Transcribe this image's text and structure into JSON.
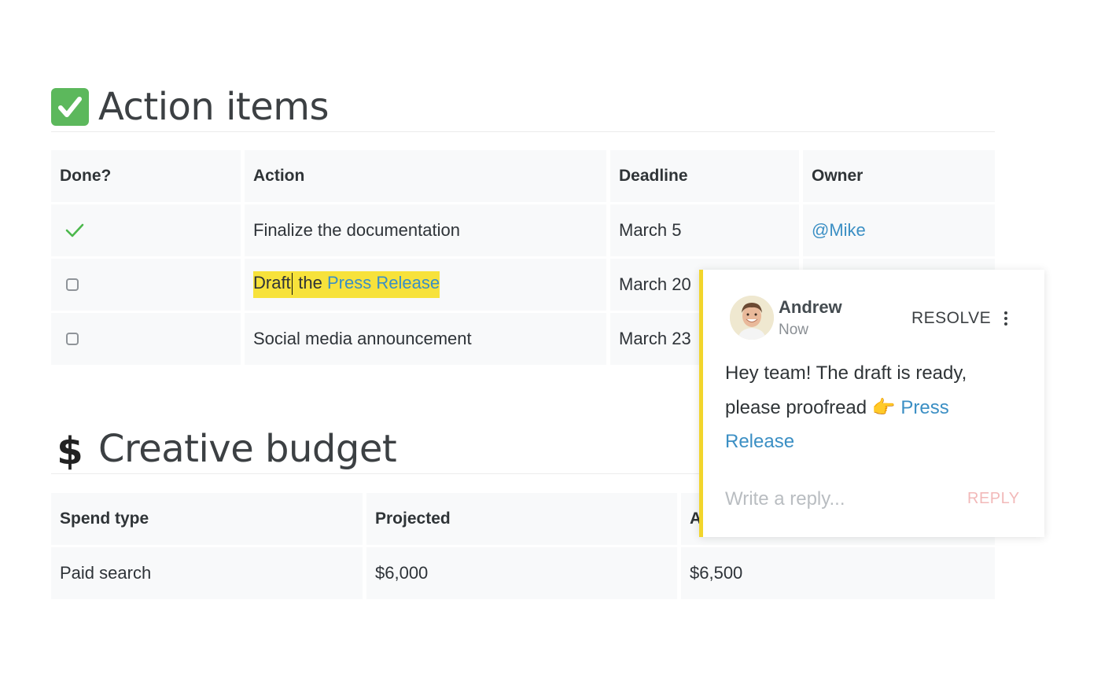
{
  "action_items": {
    "title": "Action items",
    "columns": [
      "Done?",
      "Action",
      "Deadline",
      "Owner"
    ],
    "rows": [
      {
        "done": true,
        "action": "Finalize the documentation",
        "deadline": "March 5",
        "owner": "@Mike"
      },
      {
        "done": false,
        "action_plain": "Draft",
        "action_mid": " the ",
        "action_link": "Press Release",
        "deadline": "March 20",
        "owner": ""
      },
      {
        "done": false,
        "action": "Social media announcement",
        "deadline": "March 23",
        "owner": ""
      }
    ]
  },
  "creative_budget": {
    "title": "Creative budget",
    "icon_glyph": "$",
    "columns": [
      "Spend type",
      "Projected",
      "A"
    ],
    "rows": [
      {
        "spend_type": "Paid search",
        "projected": "$6,000",
        "actual": "$6,500"
      }
    ]
  },
  "comment": {
    "author": "Andrew",
    "time": "Now",
    "resolve_label": "RESOLVE",
    "text_prefix": "Hey team! The draft is ready, please proofread ",
    "pointer_emoji": "👉",
    "link_text": "Press Release",
    "reply_placeholder": "Write a reply...",
    "reply_label": "REPLY"
  },
  "colors": {
    "accent_link": "#3b8fc4",
    "highlight": "#f7e23b",
    "comment_bar": "#f2d52b",
    "check_green": "#5cb85c"
  }
}
